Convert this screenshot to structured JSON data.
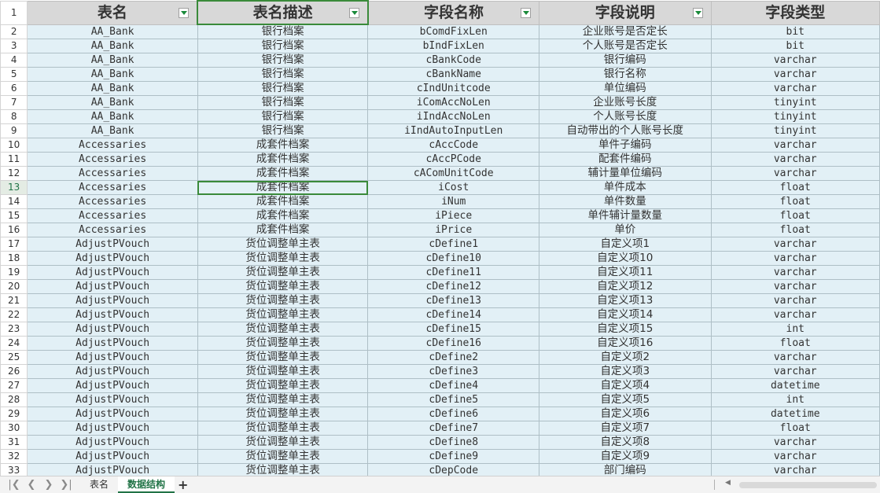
{
  "headers": [
    "表名",
    "表名描述",
    "字段名称",
    "字段说明",
    "字段类型"
  ],
  "header_row_number": "1",
  "rows": [
    {
      "n": "2",
      "t": "AA_Bank",
      "d": "银行档案",
      "f": "bComdFixLen",
      "s": "企业账号是否定长",
      "y": "bit"
    },
    {
      "n": "3",
      "t": "AA_Bank",
      "d": "银行档案",
      "f": "bIndFixLen",
      "s": "个人账号是否定长",
      "y": "bit"
    },
    {
      "n": "4",
      "t": "AA_Bank",
      "d": "银行档案",
      "f": "cBankCode",
      "s": "银行编码",
      "y": "varchar"
    },
    {
      "n": "5",
      "t": "AA_Bank",
      "d": "银行档案",
      "f": "cBankName",
      "s": "银行名称",
      "y": "varchar"
    },
    {
      "n": "6",
      "t": "AA_Bank",
      "d": "银行档案",
      "f": "cIndUnitcode",
      "s": "单位编码",
      "y": "varchar"
    },
    {
      "n": "7",
      "t": "AA_Bank",
      "d": "银行档案",
      "f": "iComAccNoLen",
      "s": "企业账号长度",
      "y": "tinyint"
    },
    {
      "n": "8",
      "t": "AA_Bank",
      "d": "银行档案",
      "f": "iIndAccNoLen",
      "s": "个人账号长度",
      "y": "tinyint"
    },
    {
      "n": "9",
      "t": "AA_Bank",
      "d": "银行档案",
      "f": "iIndAutoInputLen",
      "s": "自动带出的个人账号长度",
      "y": "tinyint"
    },
    {
      "n": "10",
      "t": "Accessaries",
      "d": "成套件档案",
      "f": "cAccCode",
      "s": "单件子编码",
      "y": "varchar"
    },
    {
      "n": "11",
      "t": "Accessaries",
      "d": "成套件档案",
      "f": "cAccPCode",
      "s": "配套件编码",
      "y": "varchar"
    },
    {
      "n": "12",
      "t": "Accessaries",
      "d": "成套件档案",
      "f": "cAComUnitCode",
      "s": "辅计量单位编码",
      "y": "varchar"
    },
    {
      "n": "13",
      "t": "Accessaries",
      "d": "成套件档案",
      "f": "iCost",
      "s": "单件成本",
      "y": "float"
    },
    {
      "n": "14",
      "t": "Accessaries",
      "d": "成套件档案",
      "f": "iNum",
      "s": "单件数量",
      "y": "float"
    },
    {
      "n": "15",
      "t": "Accessaries",
      "d": "成套件档案",
      "f": "iPiece",
      "s": "单件辅计量数量",
      "y": "float"
    },
    {
      "n": "16",
      "t": "Accessaries",
      "d": "成套件档案",
      "f": "iPrice",
      "s": "单价",
      "y": "float"
    },
    {
      "n": "17",
      "t": "AdjustPVouch",
      "d": "货位调整单主表",
      "f": "cDefine1",
      "s": "自定义项1",
      "y": "varchar"
    },
    {
      "n": "18",
      "t": "AdjustPVouch",
      "d": "货位调整单主表",
      "f": "cDefine10",
      "s": "自定义项10",
      "y": "varchar"
    },
    {
      "n": "19",
      "t": "AdjustPVouch",
      "d": "货位调整单主表",
      "f": "cDefine11",
      "s": "自定义项11",
      "y": "varchar"
    },
    {
      "n": "20",
      "t": "AdjustPVouch",
      "d": "货位调整单主表",
      "f": "cDefine12",
      "s": "自定义项12",
      "y": "varchar"
    },
    {
      "n": "21",
      "t": "AdjustPVouch",
      "d": "货位调整单主表",
      "f": "cDefine13",
      "s": "自定义项13",
      "y": "varchar"
    },
    {
      "n": "22",
      "t": "AdjustPVouch",
      "d": "货位调整单主表",
      "f": "cDefine14",
      "s": "自定义项14",
      "y": "varchar"
    },
    {
      "n": "23",
      "t": "AdjustPVouch",
      "d": "货位调整单主表",
      "f": "cDefine15",
      "s": "自定义项15",
      "y": "int"
    },
    {
      "n": "24",
      "t": "AdjustPVouch",
      "d": "货位调整单主表",
      "f": "cDefine16",
      "s": "自定义项16",
      "y": "float"
    },
    {
      "n": "25",
      "t": "AdjustPVouch",
      "d": "货位调整单主表",
      "f": "cDefine2",
      "s": "自定义项2",
      "y": "varchar"
    },
    {
      "n": "26",
      "t": "AdjustPVouch",
      "d": "货位调整单主表",
      "f": "cDefine3",
      "s": "自定义项3",
      "y": "varchar"
    },
    {
      "n": "27",
      "t": "AdjustPVouch",
      "d": "货位调整单主表",
      "f": "cDefine4",
      "s": "自定义项4",
      "y": "datetime"
    },
    {
      "n": "28",
      "t": "AdjustPVouch",
      "d": "货位调整单主表",
      "f": "cDefine5",
      "s": "自定义项5",
      "y": "int"
    },
    {
      "n": "29",
      "t": "AdjustPVouch",
      "d": "货位调整单主表",
      "f": "cDefine6",
      "s": "自定义项6",
      "y": "datetime"
    },
    {
      "n": "30",
      "t": "AdjustPVouch",
      "d": "货位调整单主表",
      "f": "cDefine7",
      "s": "自定义项7",
      "y": "float"
    },
    {
      "n": "31",
      "t": "AdjustPVouch",
      "d": "货位调整单主表",
      "f": "cDefine8",
      "s": "自定义项8",
      "y": "varchar"
    },
    {
      "n": "32",
      "t": "AdjustPVouch",
      "d": "货位调整单主表",
      "f": "cDefine9",
      "s": "自定义项9",
      "y": "varchar"
    },
    {
      "n": "33",
      "t": "AdjustPVouch",
      "d": "货位调整单主表",
      "f": "cDepCode",
      "s": "部门编码",
      "y": "varchar"
    }
  ],
  "active_cell": {
    "row": "13",
    "column": "表名描述"
  },
  "tabs": {
    "nav_icons": [
      "first-sheet-icon",
      "prev-sheet-icon",
      "next-sheet-icon",
      "last-sheet-icon"
    ],
    "sheets": [
      "表名",
      "数据结构"
    ],
    "active_sheet": "数据结构",
    "add_label": "+"
  },
  "colors": {
    "header_bg": "#d8d8d8",
    "cell_bg": "#e2f0f6",
    "accent": "#217346"
  }
}
